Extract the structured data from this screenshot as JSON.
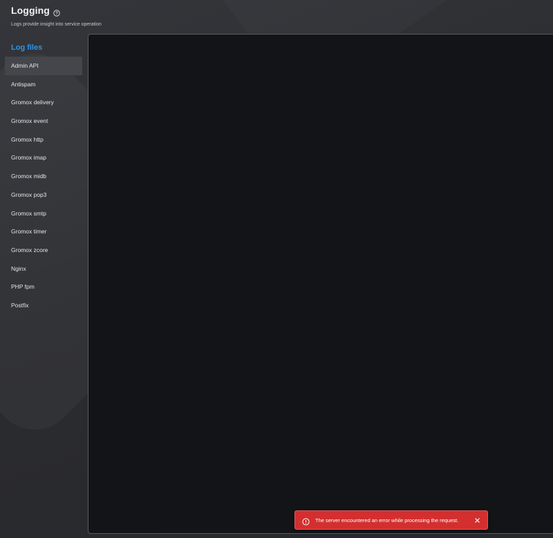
{
  "header": {
    "title": "Logging",
    "subtitle": "Logs provide insight into service operation",
    "help_icon": "help-circle-icon"
  },
  "sidebar": {
    "heading": "Log files",
    "selected": "Admin API",
    "items": [
      {
        "label": "Admin API"
      },
      {
        "label": "Antispam"
      },
      {
        "label": "Gromox delivery"
      },
      {
        "label": "Gromox event"
      },
      {
        "label": "Gromox http"
      },
      {
        "label": "Gromox imap"
      },
      {
        "label": "Gromox midb"
      },
      {
        "label": "Gromox pop3"
      },
      {
        "label": "Gromox smtp"
      },
      {
        "label": "Gromox timer"
      },
      {
        "label": "Gromox zcore"
      },
      {
        "label": "Nginx"
      },
      {
        "label": "PHP fpm"
      },
      {
        "label": "Postfix"
      }
    ]
  },
  "toast": {
    "message": "The server encountered an error while processing the request.",
    "icon": "error-outline-icon",
    "close_icon": "close-icon",
    "color": "#d32f2f"
  },
  "colors": {
    "accent": "#2b95e9",
    "background": "#2c2d31",
    "panel": "#131417"
  }
}
